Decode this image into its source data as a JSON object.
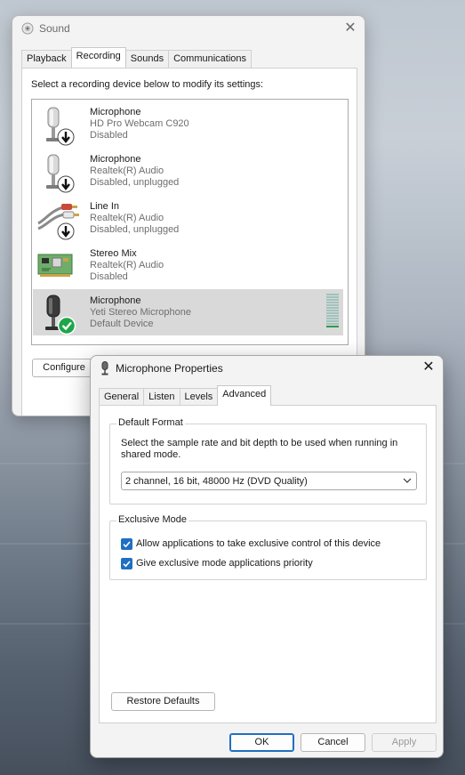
{
  "sound_window": {
    "title": "Sound",
    "close_glyph": "✕",
    "tabs": [
      "Playback",
      "Recording",
      "Sounds",
      "Communications"
    ],
    "active_tab": "Recording",
    "instruction": "Select a recording device below to modify its settings:",
    "devices": [
      {
        "name": "Microphone",
        "sub": "HD Pro Webcam C920",
        "status": "Disabled",
        "icon": "microphone-disabled-icon"
      },
      {
        "name": "Microphone",
        "sub": "Realtek(R) Audio",
        "status": "Disabled, unplugged",
        "icon": "microphone-disabled-icon"
      },
      {
        "name": "Line In",
        "sub": "Realtek(R) Audio",
        "status": "Disabled, unplugged",
        "icon": "line-in-cable-icon"
      },
      {
        "name": "Stereo Mix",
        "sub": "Realtek(R) Audio",
        "status": "Disabled",
        "icon": "stereo-mix-card-icon"
      },
      {
        "name": "Microphone",
        "sub": "Yeti Stereo Microphone",
        "status": "Default Device",
        "icon": "microphone-default-icon"
      }
    ],
    "level_meter": 0.1,
    "configure_label": "Configure"
  },
  "mic_properties": {
    "title": "Microphone Properties",
    "close_glyph": "✕",
    "tabs": [
      "General",
      "Listen",
      "Levels",
      "Advanced"
    ],
    "active_tab": "Advanced",
    "default_format": {
      "legend": "Default Format",
      "description": "Select the sample rate and bit depth to be used when running in shared mode.",
      "selected": "2 channel, 16 bit, 48000 Hz (DVD Quality)"
    },
    "exclusive_mode": {
      "legend": "Exclusive Mode",
      "allow_label": "Allow applications to take exclusive control of this device",
      "allow_checked": true,
      "priority_label": "Give exclusive mode applications priority",
      "priority_checked": true
    },
    "restore_defaults_label": "Restore Defaults",
    "ok_label": "OK",
    "cancel_label": "Cancel",
    "apply_label": "Apply"
  },
  "colors": {
    "accent": "#1f6fc2",
    "selected_row": "#d9d9d9",
    "meter_active": "#2e9b4a",
    "status_default": "#1ea64a"
  }
}
